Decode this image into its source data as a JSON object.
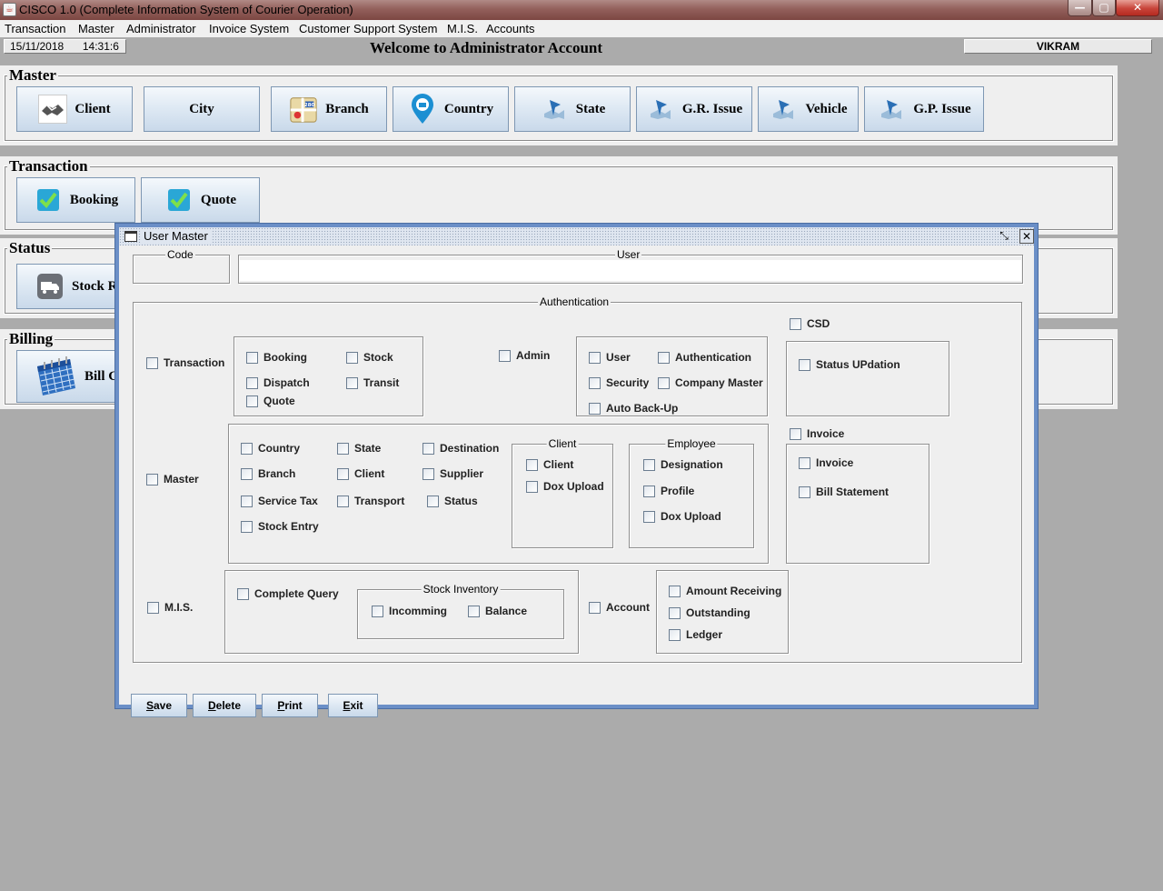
{
  "window": {
    "title": "CISCO 1.0 (Complete Information System of Courier Operation)",
    "minimize_glyph": "—",
    "maximize_glyph": "▢",
    "close_glyph": "✕"
  },
  "menu": {
    "items": [
      "Transaction",
      "Master",
      "Administrator",
      "Invoice System",
      "Customer Support System",
      "M.I.S.",
      "Accounts"
    ]
  },
  "info": {
    "date": "15/11/2018",
    "time": "14:31:6",
    "welcome": "Welcome to Administrator Account",
    "user": "VIKRAM"
  },
  "master_panel": {
    "title": "Master",
    "buttons": [
      "Client",
      "City",
      "Branch",
      "Country",
      "State",
      "G.R. Issue",
      "Vehicle",
      "G.P. Issue"
    ]
  },
  "transaction_panel": {
    "title": "Transaction",
    "buttons": [
      "Booking",
      "Quote"
    ]
  },
  "status_panel": {
    "title": "Status",
    "buttons": [
      "Stock R"
    ]
  },
  "billing_panel": {
    "title": "Billing",
    "buttons": [
      "Bill G"
    ]
  },
  "user_master": {
    "title": "User Master",
    "code_label": "Code",
    "user_label": "User",
    "code_value": "",
    "user_value": "",
    "authentication_label": "Authentication",
    "transaction": {
      "label": "Transaction",
      "items": [
        "Booking",
        "Stock",
        "Dispatch",
        "Transit",
        "Quote"
      ]
    },
    "admin": {
      "label": "Admin",
      "items": [
        "User",
        "Authentication",
        "Security",
        "Company Master",
        "Auto Back-Up"
      ]
    },
    "csd": {
      "label": "CSD",
      "items": [
        "Status UPdation"
      ]
    },
    "master": {
      "label": "Master",
      "items": [
        "Country",
        "State",
        "Destination",
        "Branch",
        "Client",
        "Supplier",
        "Service Tax",
        "Transport",
        "Status",
        "Stock Entry"
      ],
      "client_group": {
        "label": "Client",
        "items": [
          "Client",
          "Dox Upload"
        ]
      },
      "employee_group": {
        "label": "Employee",
        "items": [
          "Designation",
          "Profile",
          "Dox Upload"
        ]
      }
    },
    "invoice": {
      "label": "Invoice",
      "items": [
        "Invoice",
        "Bill Statement"
      ]
    },
    "mis": {
      "label": "M.I.S.",
      "complete_query": "Complete Query",
      "stock_inventory": {
        "label": "Stock Inventory",
        "items": [
          "Incomming",
          "Balance"
        ]
      }
    },
    "account": {
      "label": "Account",
      "items": [
        "Amount Receiving",
        "Outstanding",
        "Ledger"
      ]
    },
    "buttons": {
      "save": {
        "mnemonic": "S",
        "rest": "ave"
      },
      "delete": {
        "mnemonic": "D",
        "rest": "elete"
      },
      "print": {
        "mnemonic": "P",
        "rest": "rint"
      },
      "exit": {
        "mnemonic": "E",
        "rest": "xit"
      }
    }
  }
}
